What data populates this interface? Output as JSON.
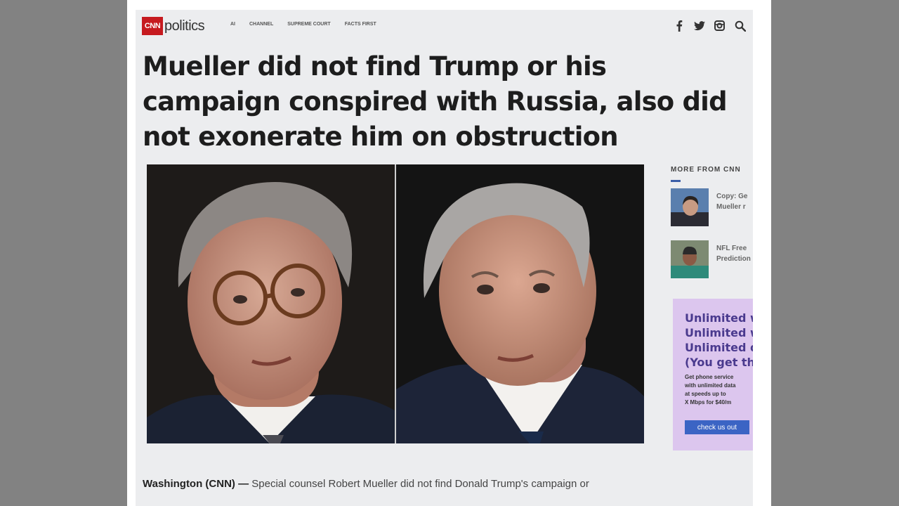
{
  "header": {
    "logo_mark": "CNN",
    "section": "politics",
    "nav": [
      "AI",
      "CHANNEL",
      "SUPREME COURT",
      "FACTS FIRST"
    ]
  },
  "social_icons": [
    "facebook-icon",
    "twitter-icon",
    "instagram-icon",
    "search-icon"
  ],
  "headline": "Mueller did not find Trump or his campaign conspired with Russia, also did not exonerate him on obstruction",
  "rail": {
    "title": "MORE FROM CNN",
    "items": [
      {
        "text_line1": "Copy: Ge",
        "text_line2": "Mueller r"
      },
      {
        "text_line1": "NFL Free",
        "text_line2": "Prediction"
      }
    ]
  },
  "ad": {
    "lines": [
      "Unlimited w",
      "Unlimited w",
      "Unlimited d",
      "(You get the"
    ],
    "body": [
      "Get phone service",
      "with unlimited data",
      "at speeds up to",
      "X Mbps for $40/m"
    ],
    "button": "check us out"
  },
  "article": {
    "dateline": "Washington (CNN) —",
    "text": " Special counsel Robert Mueller did not find Donald Trump's campaign or"
  },
  "colors": {
    "cnn_red": "#c61a1f",
    "ad_bg": "#dcc6ee",
    "ad_text": "#4a3a8e",
    "ad_button": "#3b64c4",
    "page_bg": "#ecedef"
  }
}
